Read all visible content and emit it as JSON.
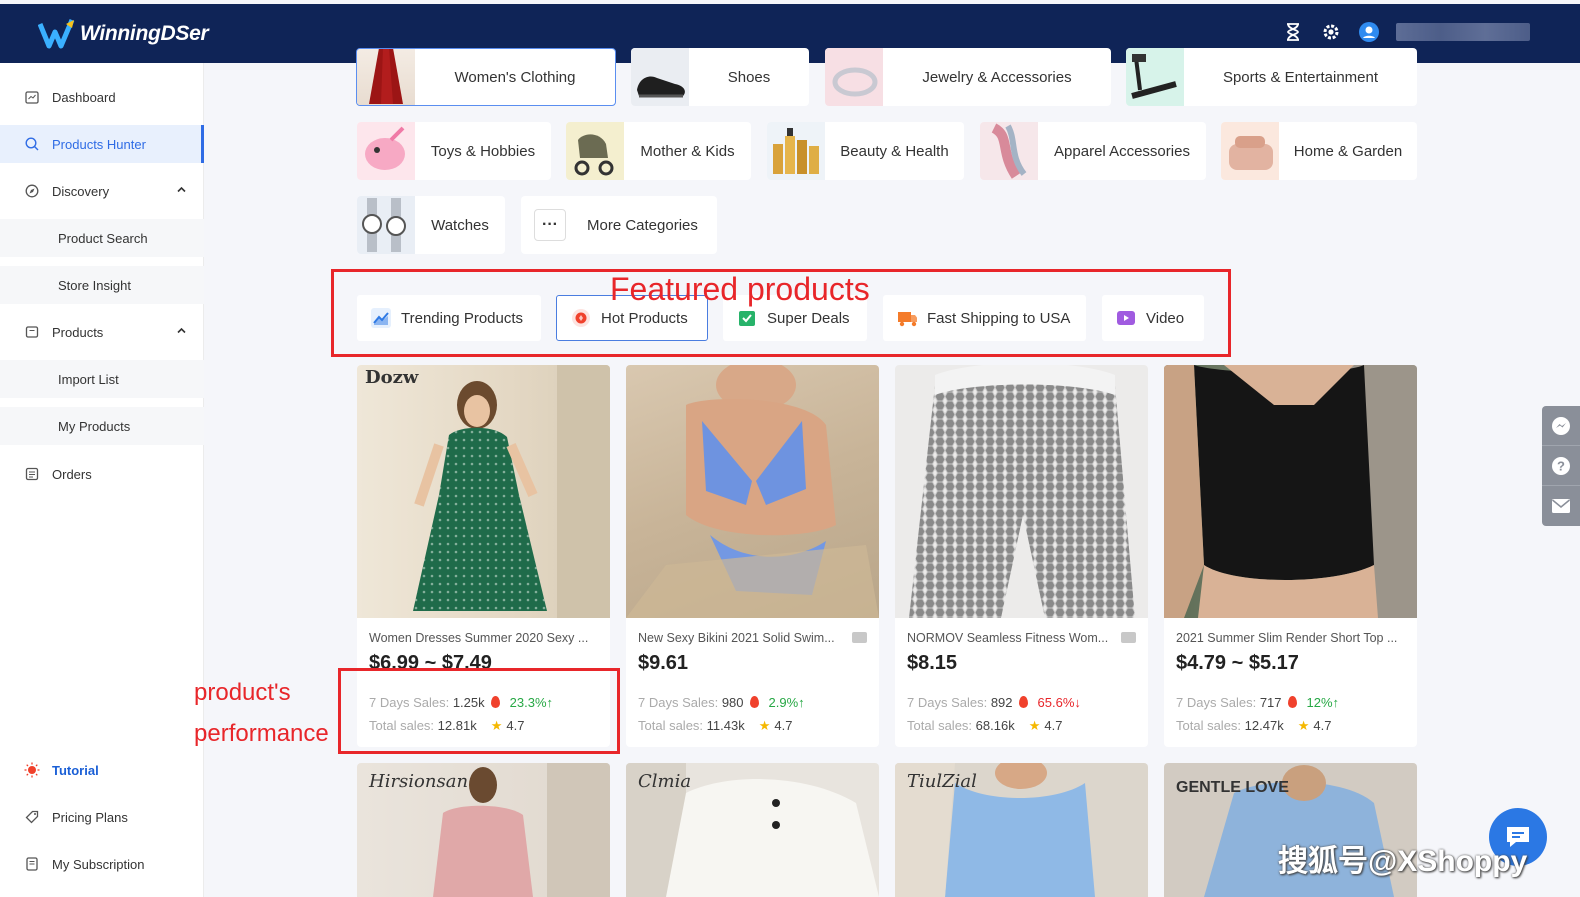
{
  "app": {
    "logo_text": "WinningDSer"
  },
  "header": {
    "icons": [
      "hourglass-icon",
      "gear-icon",
      "user-avatar-icon"
    ]
  },
  "sidebar": {
    "items": [
      {
        "label": "Dashboard",
        "icon": "dashboard-icon"
      },
      {
        "label": "Products Hunter",
        "icon": "search-icon",
        "active": true
      },
      {
        "label": "Discovery",
        "icon": "compass-icon",
        "expanded": true
      },
      {
        "label": "Product Search"
      },
      {
        "label": "Store Insight"
      },
      {
        "label": "Products",
        "icon": "box-icon",
        "expanded": true
      },
      {
        "label": "Import List"
      },
      {
        "label": "My Products"
      },
      {
        "label": "Orders",
        "icon": "orders-icon"
      }
    ],
    "bottom": [
      {
        "label": "Tutorial",
        "icon": "bulb-icon"
      },
      {
        "label": "Pricing Plans",
        "icon": "tag-icon"
      },
      {
        "label": "My Subscription",
        "icon": "subscription-icon"
      }
    ]
  },
  "categories": {
    "row1": [
      "Women's Clothing",
      "Shoes",
      "Jewelry & Accessories",
      "Sports & Entertainment"
    ],
    "row2": [
      "Toys & Hobbies",
      "Mother & Kids",
      "Beauty & Health",
      "Apparel Accessories",
      "Home & Garden"
    ],
    "row3": [
      "Watches",
      "More Categories"
    ]
  },
  "tabs": [
    {
      "label": "Trending Products",
      "icon": "chart-icon",
      "color": "#2f7ae5"
    },
    {
      "label": "Hot Products",
      "icon": "fire-icon",
      "color": "#f0412c",
      "selected": true
    },
    {
      "label": "Super Deals",
      "icon": "deal-icon",
      "color": "#27b36a"
    },
    {
      "label": "Fast Shipping to USA",
      "icon": "truck-icon",
      "color": "#f47b2a"
    },
    {
      "label": "Video",
      "icon": "video-icon",
      "color": "#a05be0"
    }
  ],
  "annotations": {
    "featured": "Featured products",
    "performance_line1": "product's",
    "performance_line2": "performance"
  },
  "products": [
    {
      "title": "Women Dresses Summer 2020 Sexy ...",
      "price": "$6.99 ~ $7.49",
      "days_label": "7 Days Sales:",
      "days_sales": "1.25k",
      "change": "23.3%↑",
      "trend": "up",
      "total_label": "Total sales:",
      "total_sales": "12.81k",
      "rating": "4.7",
      "has_video": false
    },
    {
      "title": "New Sexy Bikini 2021 Solid Swim...",
      "price": "$9.61",
      "days_label": "7 Days Sales:",
      "days_sales": "980",
      "change": "2.9%↑",
      "trend": "up",
      "total_label": "Total sales:",
      "total_sales": "11.43k",
      "rating": "4.7",
      "has_video": true
    },
    {
      "title": "NORMOV Seamless Fitness Wom...",
      "price": "$8.15",
      "days_label": "7 Days Sales:",
      "days_sales": "892",
      "change": "65.6%↓",
      "trend": "down",
      "total_label": "Total sales:",
      "total_sales": "68.16k",
      "rating": "4.7",
      "has_video": true
    },
    {
      "title": "2021 Summer Slim Render Short Top ...",
      "price": "$4.79 ~ $5.17",
      "days_label": "7 Days Sales:",
      "days_sales": "717",
      "change": "12%↑",
      "trend": "up",
      "total_label": "Total sales:",
      "total_sales": "12.47k",
      "rating": "4.7",
      "has_video": false
    }
  ],
  "product_brands": [
    "Dozw",
    "Hirsionsan",
    "Clmia",
    "TiulZial",
    "GENTLE LOVE"
  ],
  "watermark": "搜狐号@XShoppy"
}
